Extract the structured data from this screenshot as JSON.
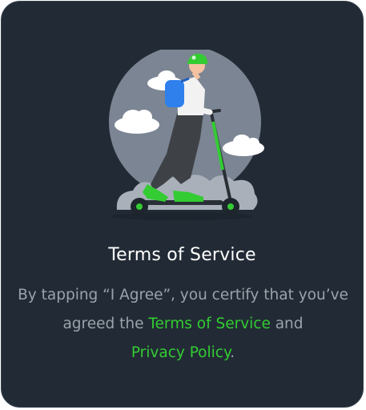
{
  "dialog": {
    "title": "Terms of Service",
    "body": {
      "part1": "By tapping “I Agree”, you certify that you’ve agreed the ",
      "terms_link": "Terms of Service",
      "part2": " and ",
      "privacy_link": "Privacy Policy",
      "part3": "."
    }
  },
  "colors": {
    "background": "#222b35",
    "accent": "#33cc33",
    "title": "#ffffff",
    "body": "#9aa2ab"
  },
  "icons": {
    "illustration": "scooter-rider-illustration"
  }
}
